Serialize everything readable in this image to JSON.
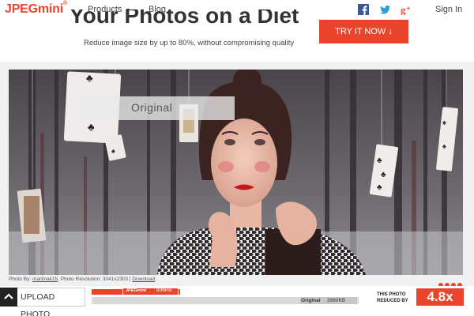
{
  "header": {
    "logo": "JPEGmini",
    "logo_mark": "®",
    "nav": [
      {
        "label": "Products",
        "has_caret": true
      },
      {
        "label": "Blog"
      }
    ],
    "social": [
      "facebook-icon",
      "twitter-icon",
      "google-plus-icon"
    ],
    "signin": "Sign In"
  },
  "hero": {
    "title": "Your Photos on a Diet",
    "subtitle": "Reduce image size by up to 80%, without compromising quality",
    "cta": "TRY IT NOW ↓"
  },
  "comparison": {
    "label": "Original",
    "credit_prefix": "Photo By: ",
    "credit_author": "martinak15",
    "credit_resolution": ", Photo Resolution: 3041x2303 | ",
    "download": "Download",
    "upload": "UPLOAD PHOTO",
    "jpegmini_name": "JPEGmini",
    "jpegmini_size": "836KB",
    "original_name": "Original",
    "original_size": "3980KB",
    "reduced_label": "THIS PHOTO REDUCED BY",
    "ratio": "4.8x",
    "slides": 4
  },
  "colors": {
    "accent": "#e8452c",
    "text": "#333333"
  }
}
